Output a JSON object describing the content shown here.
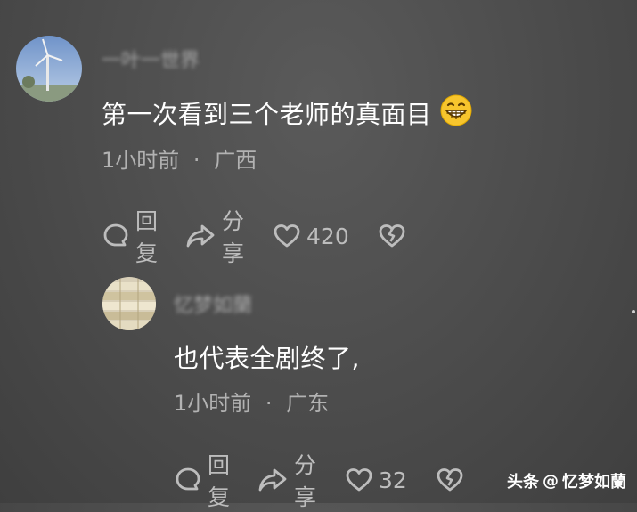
{
  "comments": [
    {
      "username": "一叶一世界",
      "text": "第一次看到三个老师的真面目",
      "emoji": "grinning-face",
      "time": "1小时前",
      "location": "广西",
      "actions": {
        "reply_label": "回复",
        "share_label": "分享",
        "like_count": "420"
      }
    },
    {
      "username": "忆梦如蘭",
      "text": "也代表全剧终了,",
      "time": "1小时前",
      "location": "广东",
      "actions": {
        "reply_label": "回复",
        "share_label": "分享",
        "like_count": "32"
      }
    }
  ],
  "meta_separator": "·",
  "watermark": {
    "platform": "头条",
    "at": "@",
    "author": "忆梦如蘭"
  },
  "colors": {
    "background": "#4a4a4a",
    "text": "#ffffff",
    "muted": "#b2b2b2",
    "emoji_fill": "#f7c52d"
  }
}
